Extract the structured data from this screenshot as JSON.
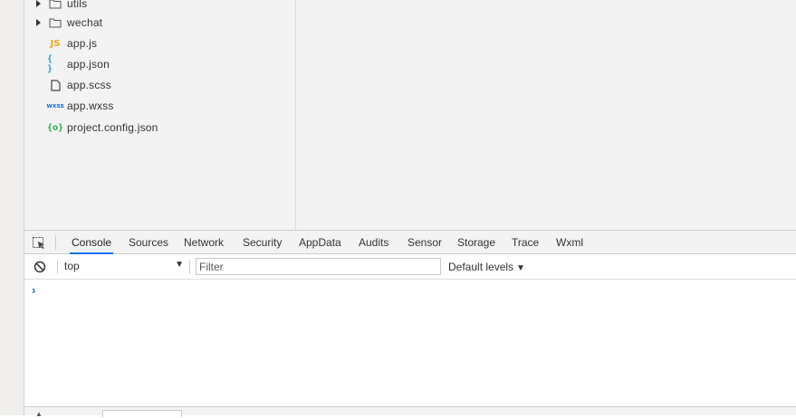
{
  "file_tree": {
    "items": [
      {
        "name": "utils",
        "type": "folder",
        "icon": "folder-icon"
      },
      {
        "name": "wechat",
        "type": "folder",
        "icon": "folder-icon"
      },
      {
        "name": "app.js",
        "type": "file",
        "icon": "js-icon",
        "icon_text": "JS"
      },
      {
        "name": "app.json",
        "type": "file",
        "icon": "json-icon",
        "icon_text": "{ }"
      },
      {
        "name": "app.scss",
        "type": "file",
        "icon": "file-icon"
      },
      {
        "name": "app.wxss",
        "type": "file",
        "icon": "wxss-icon",
        "icon_text": "wxss"
      },
      {
        "name": "project.config.json",
        "type": "file",
        "icon": "config-json-icon",
        "icon_text": "{o}"
      }
    ]
  },
  "devtools": {
    "tabs": [
      "Console",
      "Sources",
      "Network",
      "Security",
      "AppData",
      "Audits",
      "Sensor",
      "Storage",
      "Trace",
      "Wxml"
    ],
    "active_tab": "Console"
  },
  "console_toolbar": {
    "context": "top",
    "filter_placeholder": "Filter",
    "levels_label": "Default levels"
  },
  "console": {
    "prompt": "›"
  },
  "colors": {
    "accent": "#1a73e8",
    "js": "#e6a817",
    "json": "#1a9bd7",
    "config": "#2aa84a"
  }
}
